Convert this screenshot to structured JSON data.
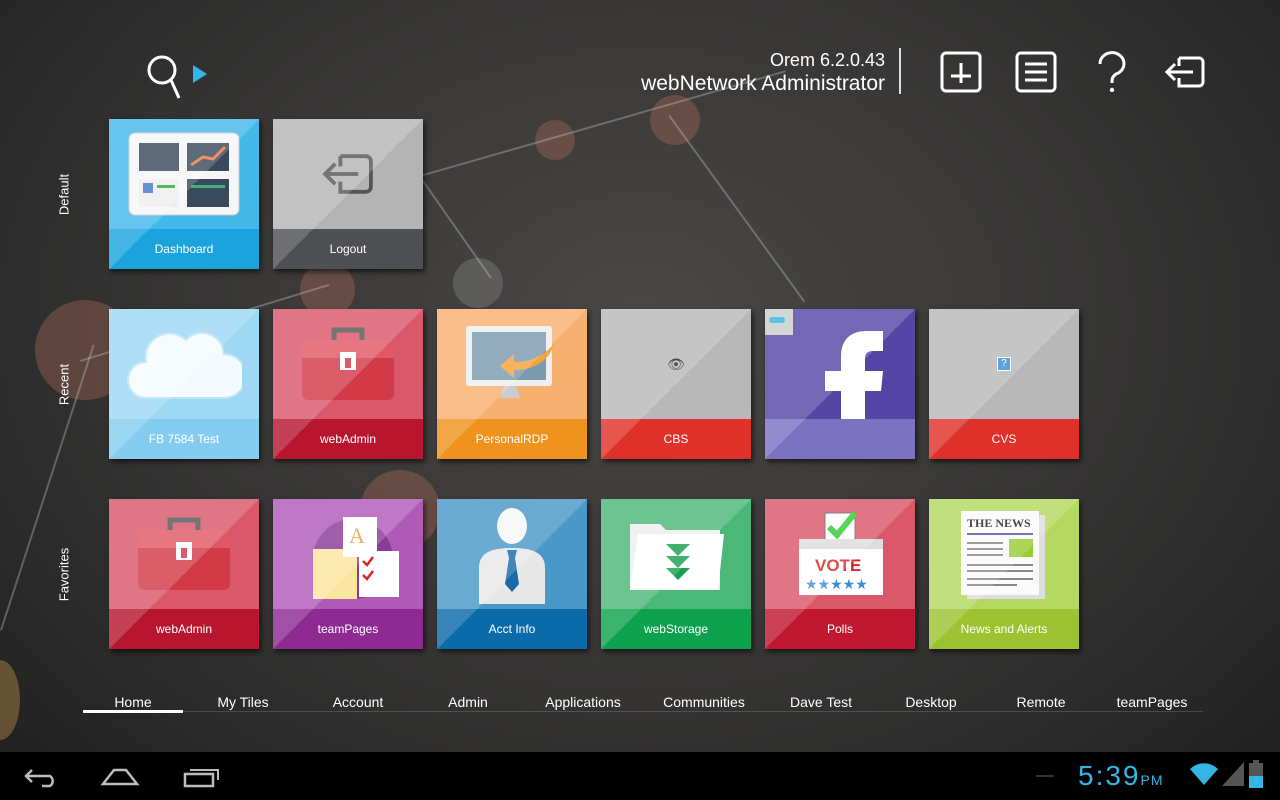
{
  "header": {
    "location": "Orem 6.2.0.43",
    "user": "webNetwork Administrator"
  },
  "toolbar": [
    {
      "icon": "add-tile-icon"
    },
    {
      "icon": "menu-list-icon"
    },
    {
      "icon": "help-icon"
    },
    {
      "icon": "logout-icon"
    }
  ],
  "sections": [
    {
      "label": "Default",
      "tiles": [
        {
          "label": "Dashboard",
          "bg": "#45b8ea",
          "bar": "#1ba3de",
          "icon": "dashboard-icon"
        },
        {
          "label": "Logout",
          "bg": "#b4b4b4",
          "bar": "#4e5054",
          "icon": "logout-icon"
        }
      ]
    },
    {
      "label": "Recent",
      "tiles": [
        {
          "label": "FB 7584 Test",
          "bg": "#9ed8f4",
          "bar": "#84ccf0",
          "icon": "cloud-icon"
        },
        {
          "label": "webAdmin",
          "bg": "#d9586a",
          "bar": "#b7162e",
          "icon": "toolbox-icon"
        },
        {
          "label": "PersonalRDP",
          "bg": "#f8b070",
          "bar": "#f0921e",
          "icon": "remote-desktop-icon"
        },
        {
          "label": "CBS",
          "bg": "#b8b8b8",
          "bar": "#e0302a",
          "icon": "eye-icon"
        },
        {
          "label": "",
          "bg": "#5546a6",
          "bar": "#7b72c2",
          "icon": "facebook-icon"
        },
        {
          "label": "CVS",
          "bg": "#b8b8b8",
          "bar": "#e0302a",
          "icon": "help-small-icon"
        }
      ]
    },
    {
      "label": "Favorites",
      "tiles": [
        {
          "label": "webAdmin",
          "bg": "#d9586a",
          "bar": "#b7162e",
          "icon": "toolbox-icon"
        },
        {
          "label": "teamPages",
          "bg": "#b05ab8",
          "bar": "#8e2a92",
          "icon": "team-pages-icon"
        },
        {
          "label": "Acct Info",
          "bg": "#4a98c8",
          "bar": "#0b6aa8",
          "icon": "user-icon"
        },
        {
          "label": "webStorage",
          "bg": "#4cb878",
          "bar": "#0ea24e",
          "icon": "folder-icon"
        },
        {
          "label": "Polls",
          "bg": "#d9586a",
          "bar": "#c01830",
          "icon": "vote-box-icon"
        },
        {
          "label": "News and Alerts",
          "bg": "#b4d860",
          "bar": "#9cc232",
          "icon": "newspaper-icon"
        }
      ]
    }
  ],
  "icon_text": {
    "vote": "VOTE",
    "stars": "★★★★★",
    "news": "THE NEWS",
    "fb": "f"
  },
  "nav": {
    "active": "Home",
    "tabs": [
      "Home",
      "My Tiles",
      "Account",
      "Admin",
      "Applications",
      "Communities",
      "Dave Test",
      "Desktop",
      "Remote",
      "teamPages"
    ]
  },
  "status_bar": {
    "time": "5:39",
    "ampm": "PM",
    "accent": "#33b5e5"
  }
}
